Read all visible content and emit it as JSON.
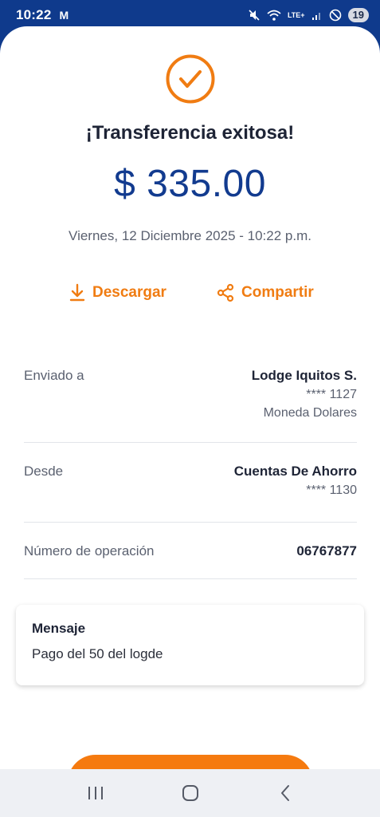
{
  "status_bar": {
    "time": "10:22",
    "mail_icon": "M",
    "network": "LTE+",
    "badge": "19"
  },
  "receipt": {
    "title": "¡Transferencia exitosa!",
    "amount": "$ 335.00",
    "datetime": "Viernes, 12 Diciembre 2025 - 10:22 p.m."
  },
  "actions": {
    "download_label": "Descargar",
    "share_label": "Compartir"
  },
  "details": {
    "sent_to": {
      "label": "Enviado a",
      "name": "Lodge Iquitos S.",
      "account": "**** 1127",
      "currency": "Moneda Dolares"
    },
    "from": {
      "label": "Desde",
      "name": "Cuentas De Ahorro",
      "account": "**** 1130"
    },
    "operation": {
      "label": "Número de operación",
      "number": "06767877"
    }
  },
  "message": {
    "title": "Mensaje",
    "text": "Pago del 50 del logde"
  },
  "colors": {
    "accent": "#f57a0f",
    "brand_blue": "#123b8f",
    "status_bar": "#0f3a8c"
  },
  "icons": {
    "success": "check-circle-icon",
    "download": "download-icon",
    "share": "share-icon",
    "nav_recents": "recents-icon",
    "nav_home": "home-icon",
    "nav_back": "back-icon"
  }
}
